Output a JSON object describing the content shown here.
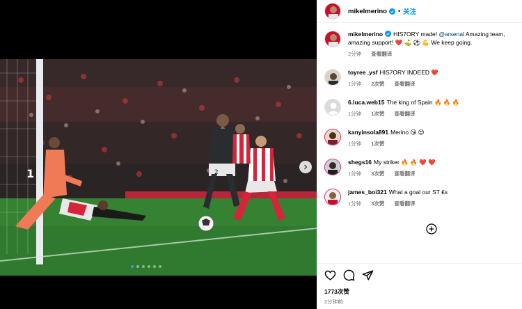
{
  "post": {
    "username": "mikelmerino",
    "follow_label": "关注",
    "separator": "•",
    "caption_user": "mikelmerino",
    "caption_text_1": "HIS7ORY made!",
    "caption_mention": "@arsenal",
    "caption_text_2": "Amazing team, amazing support! ❤️ ⛳ ⚽ 💪 We keep going.",
    "caption_time": "2分钟",
    "caption_translate": "查看翻译",
    "likes": "1773次赞",
    "posted_ago": "2分钟前"
  },
  "comments": [
    {
      "user": "toyree_ysf",
      "text": "HIS7ORY INDEED ❤️",
      "time": "1分钟",
      "likes": "2次赞",
      "translate": "查看翻译"
    },
    {
      "user": "6.luca.web15",
      "text": "The king of Spain 🔥 🔥 🔥",
      "time": "1分钟",
      "likes": "1次赞",
      "translate": "查看翻译"
    },
    {
      "user": "kanyinsola891",
      "text": "Merino 😘 😍",
      "time": "1分钟",
      "likes": "1次赞",
      "translate": ""
    },
    {
      "user": "shegs16",
      "text": "My striker 🔥 🔥 ❤️ ❤️",
      "time": "1分钟",
      "likes": "3次赞",
      "translate": "查看翻译"
    },
    {
      "user": "james_boi321",
      "text": "What a goal our ST ₤s",
      "time": "1分钟",
      "likes": "3次赞",
      "translate": "查看翻译"
    }
  ],
  "icons": {
    "like": "heart-icon",
    "comment": "comment-icon",
    "share": "share-icon",
    "more_comments": "plus-circle-icon",
    "next": "chevron-right-icon"
  },
  "colors": {
    "accent": "#0095f6",
    "heart": "#ed4956",
    "meta": "#737373"
  }
}
